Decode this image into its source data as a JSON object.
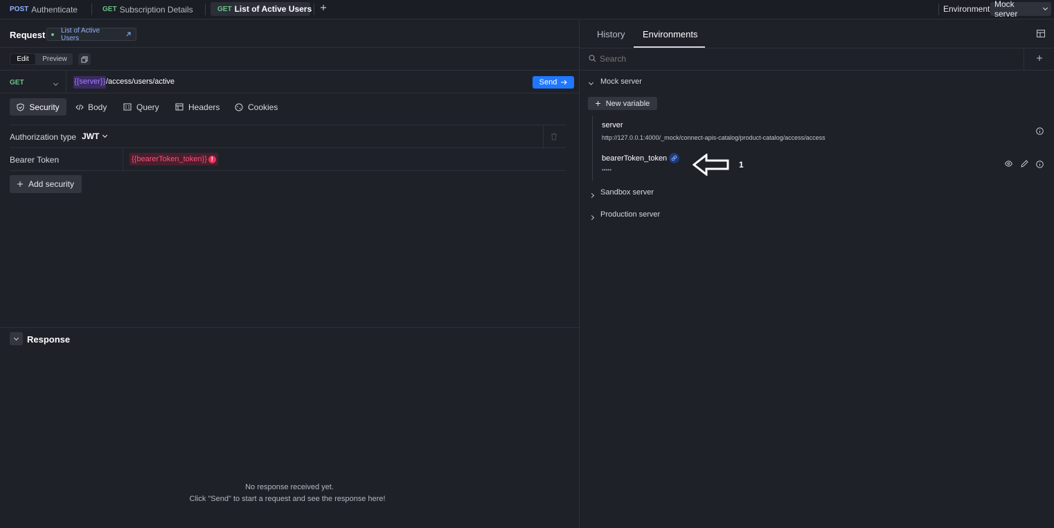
{
  "tabs": [
    {
      "method": "POST",
      "label": "Authenticate",
      "method_color": "#8fb4ff"
    },
    {
      "method": "GET",
      "label": "Subscription Details",
      "method_color": "#6cc38a"
    },
    {
      "method": "GET",
      "label": "List of Active Users",
      "method_color": "#6cc38a",
      "active": true
    }
  ],
  "tabbar": {
    "add_icon": "plus-icon",
    "environment_label": "Environment",
    "environment_value": "Mock server"
  },
  "request": {
    "title": "Request",
    "linked_name": "List of Active Users",
    "edit_label": "Edit",
    "preview_label": "Preview",
    "method": "GET",
    "url_var": "{{server}}",
    "url_path": "/access/users/active",
    "send_label": "Send",
    "subtabs": [
      "Security",
      "Body",
      "Query",
      "Headers",
      "Cookies"
    ],
    "auth_type_label": "Authorization type",
    "auth_type_value": "JWT",
    "bearer_label": "Bearer Token",
    "bearer_value": "{{bearerToken_token}}",
    "add_security_label": "Add security"
  },
  "response": {
    "title": "Response",
    "empty_line1": "No response received yet.",
    "empty_line2": "Click \"Send\" to start a request and see the response here!"
  },
  "sidebar": {
    "tabs": [
      "History",
      "Environments"
    ],
    "active_tab": "Environments",
    "search_placeholder": "Search",
    "groups": [
      {
        "name": "Mock server",
        "expanded": true
      },
      {
        "name": "Sandbox server",
        "expanded": false
      },
      {
        "name": "Production server",
        "expanded": false
      }
    ],
    "new_variable_label": "New variable",
    "variables": [
      {
        "name": "server",
        "value": "http://127.0.0.1:4000/_mock/connect-apis-catalog/product-catalog/access/access"
      },
      {
        "name": "bearerToken_token",
        "value": "•••••"
      }
    ],
    "annotation_number": "1"
  },
  "colors": {
    "accent": "#1f78ff",
    "error": "#e6315b",
    "var_purple": "#a57bff",
    "get_green": "#6cc38a"
  }
}
